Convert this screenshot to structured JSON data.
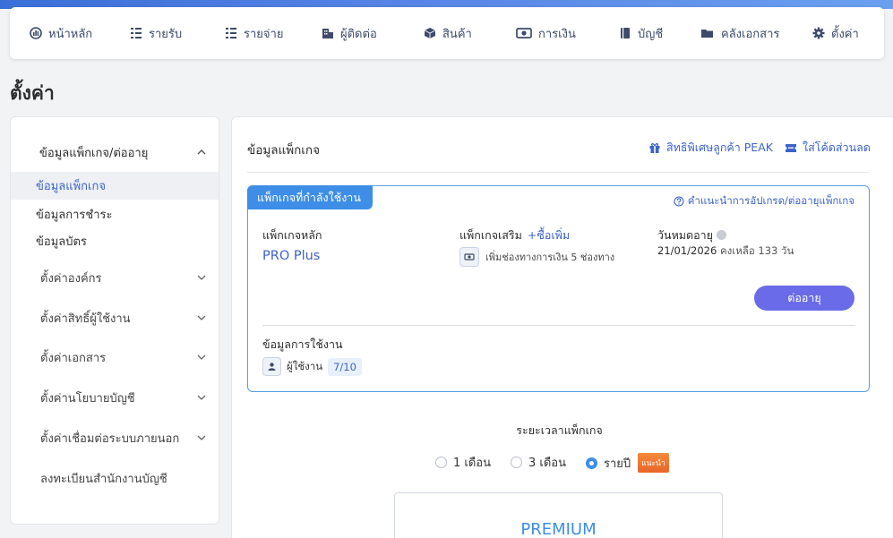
{
  "nav": {
    "items": [
      {
        "label": "หน้าหลัก",
        "icon": "dashboard-icon"
      },
      {
        "label": "รายรับ",
        "icon": "income-icon"
      },
      {
        "label": "รายจ่าย",
        "icon": "expense-icon"
      },
      {
        "label": "ผู้ติดต่อ",
        "icon": "contacts-icon"
      },
      {
        "label": "สินค้า",
        "icon": "box-icon"
      },
      {
        "label": "การเงิน",
        "icon": "money-icon"
      },
      {
        "label": "บัญชี",
        "icon": "book-icon"
      },
      {
        "label": "คลังเอกสาร",
        "icon": "folder-icon"
      },
      {
        "label": "ตั้งค่า",
        "icon": "gear-icon"
      }
    ],
    "accent": "#3d4a6b"
  },
  "page": {
    "title": "ตั้งค่า"
  },
  "sidebar": {
    "section": {
      "label": "ข้อมูลแพ็กเกจ/ต่ออายุ"
    },
    "sub_items": [
      {
        "label": "ข้อมูลแพ็กเกจ",
        "active": true
      },
      {
        "label": "ข้อมูลการชำระ"
      },
      {
        "label": "ข้อมูลบัตร"
      }
    ],
    "groups": [
      {
        "label": "ตั้งค่าองค์กร"
      },
      {
        "label": "ตั้งค่าสิทธิ์ผู้ใช้งาน"
      },
      {
        "label": "ตั้งค่าเอกสาร"
      },
      {
        "label": "ตั้งค่านโยบายบัญชี"
      },
      {
        "label": "ตั้งค่าเชื่อมต่อระบบภายนอก"
      }
    ],
    "footer_item": {
      "label": "ลงทะเบียนสำนักงานบัญชี"
    }
  },
  "main": {
    "title": "ข้อมูลแพ็กเกจ",
    "privilege_link": "สิทธิพิเศษลูกค้า PEAK",
    "coupon_link": "ใส่โค้ดส่วนลด",
    "current_package": {
      "badge": "แพ็กเกจที่กำลังใช้งาน",
      "help_link": "คำแนะนำการอัปเกรด/ต่ออายุแพ็กเกจ",
      "main_label": "แพ็กเกจหลัก",
      "main_value": "PRO Plus",
      "addon_label": "แพ็กเกจเสริม",
      "addon_buy": "+ซื้อเพิ่ม",
      "addon_item": "เพิ่มช่องทางการเงิน 5 ช่องทาง",
      "expire_label": "วันหมดอายุ",
      "expire_date": "21/01/2026",
      "expire_remaining": "คงเหลือ 133 วัน",
      "renew_button": "ต่ออายุ",
      "usage_title": "ข้อมูลการใช้งาน",
      "usage_label": "ผู้ใช้งาน",
      "usage_count": "7/10"
    },
    "period": {
      "title": "ระยะเวลาแพ็กเกจ",
      "options": [
        {
          "label": "1 เดือน",
          "selected": false
        },
        {
          "label": "3 เดือน",
          "selected": false
        },
        {
          "label": "รายปี",
          "selected": true
        }
      ],
      "recommend_badge": "แนะนำ"
    },
    "plan_card": {
      "title": "PREMIUM"
    }
  }
}
